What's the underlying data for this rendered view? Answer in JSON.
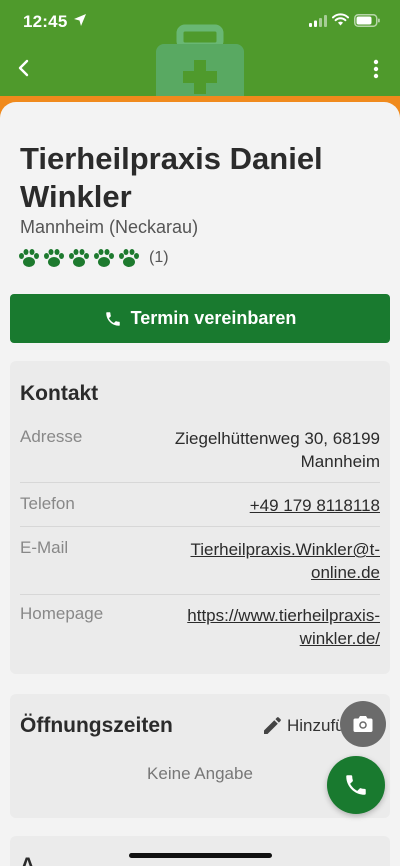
{
  "status_bar": {
    "time": "12:45"
  },
  "place": {
    "name": "Tierheilpraxis Daniel Winkler",
    "location": "Mannheim (Neckarau)",
    "rating_paws": 5,
    "rating_count": "(1)"
  },
  "cta": {
    "label": "Termin vereinbaren"
  },
  "contact": {
    "title": "Kontakt",
    "rows": [
      {
        "label": "Adresse",
        "value_line1": "Ziegelhüttenweg 30, 68199",
        "value_line2": "Mannheim"
      },
      {
        "label": "Telefon",
        "value_line1": "+49 179 8118118"
      },
      {
        "label": "E-Mail",
        "value_line1": "Tierheilpraxis.Winkler@t-",
        "value_line2": "online.de"
      },
      {
        "label": "Homepage",
        "value_line1": "https://www.tierheilpraxis-",
        "value_line2": "winkler.de/"
      }
    ]
  },
  "hours": {
    "title": "Öffnungszeiten",
    "add_label": "Hinzufü",
    "empty": "Keine Angabe"
  },
  "next_section": {
    "title_fragment": "A"
  },
  "colors": {
    "header_green": "#4f9a2c",
    "accent_orange": "#f08a1c",
    "primary_green": "#197a2f",
    "camera_fab": "#6b6b6b"
  },
  "icons": [
    "location-arrow-icon",
    "signal-icon",
    "wifi-icon",
    "battery-icon",
    "back-icon",
    "more-icon",
    "medical-case-icon",
    "paw-icon",
    "phone-icon",
    "pencil-icon",
    "camera-icon"
  ]
}
